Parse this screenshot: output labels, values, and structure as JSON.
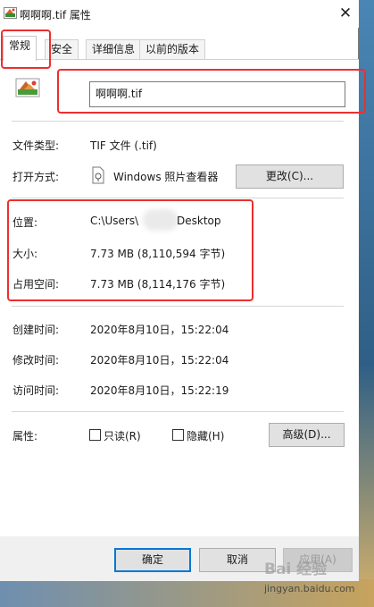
{
  "window": {
    "title": "啊啊啊.tif 属性",
    "close_glyph": "✕"
  },
  "tabs": [
    {
      "label": "常规"
    },
    {
      "label": "安全"
    },
    {
      "label": "详细信息"
    },
    {
      "label": "以前的版本"
    }
  ],
  "file": {
    "name": "啊啊啊.tif"
  },
  "info": {
    "type_label": "文件类型:",
    "type_value": "TIF 文件 (.tif)",
    "open_with_label": "打开方式:",
    "open_with_value": "Windows 照片查看器",
    "change_button": "更改(C)...",
    "location_label": "位置:",
    "location_value_prefix": "C:\\Users\\",
    "location_value_suffix": "Desktop",
    "size_label": "大小:",
    "size_value": "7.73 MB (8,110,594 字节)",
    "disk_size_label": "占用空间:",
    "disk_size_value": "7.73 MB (8,114,176 字节)",
    "created_label": "创建时间:",
    "created_value": "2020年8月10日，15:22:04",
    "modified_label": "修改时间:",
    "modified_value": "2020年8月10日，15:22:04",
    "accessed_label": "访问时间:",
    "accessed_value": "2020年8月10日，15:22:19"
  },
  "attributes": {
    "label": "属性:",
    "readonly_label": "只读(R)",
    "readonly_checked": false,
    "hidden_label": "隐藏(H)",
    "hidden_checked": false,
    "advanced_button": "高级(D)..."
  },
  "footer": {
    "ok": "确定",
    "cancel": "取消",
    "apply": "应用(A)"
  },
  "watermark": {
    "main": "Bai 经验",
    "sub": "jingyan.baidu.com"
  },
  "colors": {
    "highlight_box": "#ec2f2f",
    "focus_border": "#0078d7"
  }
}
